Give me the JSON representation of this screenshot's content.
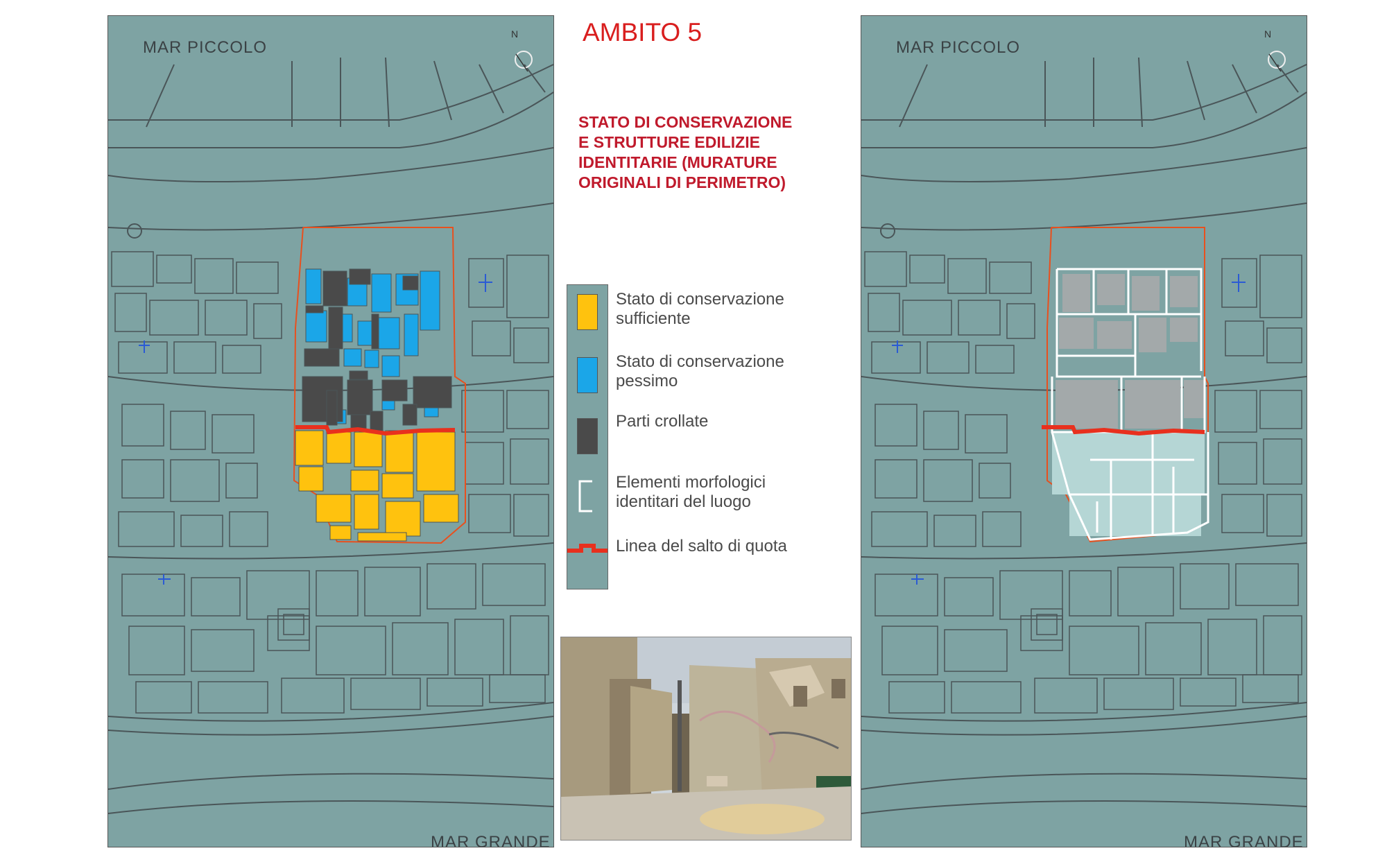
{
  "title": "AMBITO 5",
  "subtitle_lines": [
    "STATO DI CONSERVAZIONE",
    "E STRUTTURE EDILIZIE",
    "IDENTITARIE (MURATURE",
    "ORIGINALI DI PERIMETRO)"
  ],
  "map_labels": {
    "sea_north": "MAR  PICCOLO",
    "sea_south": "MAR GRANDE",
    "north_arrow": "N"
  },
  "legend": [
    {
      "label_lines": [
        "Stato di conservazione",
        "sufficiente"
      ],
      "color": "#ffc20e",
      "icon": "yellow-swatch"
    },
    {
      "label_lines": [
        "Stato di conservazione",
        "pessimo"
      ],
      "color": "#1ba6e8",
      "icon": "blue-swatch"
    },
    {
      "label_lines": [
        "Parti crollate"
      ],
      "color": "#4a4a4a",
      "icon": "dark-gray-swatch"
    },
    {
      "label_lines": [
        "Elementi morfologici",
        "identitari del luogo"
      ],
      "color": "#ffffff",
      "icon": "bracket-icon"
    },
    {
      "label_lines": [
        "Linea del salto di quota"
      ],
      "color": "#e8301e",
      "icon": "red-line-icon"
    }
  ],
  "colors": {
    "map_background": "#7ea3a3",
    "map_lines": "#4a5558",
    "perimeter": "#e8501e",
    "title": "#d91e1e",
    "collapsed_right": "#a3a9aa"
  },
  "photo": {
    "icon": "site-photo",
    "content": "courtyard-ruins"
  }
}
